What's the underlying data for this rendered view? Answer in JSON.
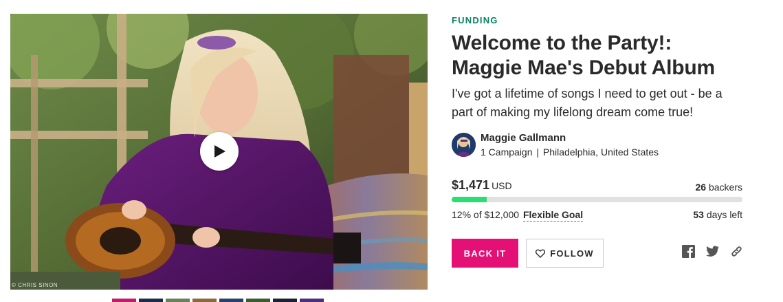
{
  "media": {
    "photo_credit": "© CHRIS SINON",
    "play_icon": "play-icon",
    "thumbnails": [
      {
        "color": "#c21b6d"
      },
      {
        "color": "#1e2a48"
      },
      {
        "color": "#6b7f5a"
      },
      {
        "color": "#8a6a3c"
      },
      {
        "color": "#2a3f6b"
      },
      {
        "color": "#3e5a2e"
      },
      {
        "color": "#1a2230"
      },
      {
        "color": "#4a2f7a"
      }
    ]
  },
  "campaign": {
    "category": "FUNDING",
    "title": "Welcome to the Party!: Maggie Mae's Debut Album",
    "tagline": "I've got a lifetime of songs I need to get out - be a part of making my lifelong dream come true!"
  },
  "owner": {
    "name": "Maggie Gallmann",
    "campaigns": "1 Campaign",
    "separator": "|",
    "location": "Philadelphia, United States"
  },
  "funding": {
    "amount": "$1,471",
    "currency": "USD",
    "backers_count": "26",
    "backers_label": "backers",
    "percent_funded": 0.12,
    "goal_text": "12% of $12,000",
    "goal_type": "Flexible Goal",
    "days_count": "53",
    "days_label": "days left"
  },
  "actions": {
    "back_label": "BACK IT",
    "follow_label": "FOLLOW",
    "follow_icon": "heart-icon"
  },
  "share": {
    "icons": [
      "facebook-icon",
      "twitter-icon",
      "link-icon"
    ]
  },
  "colors": {
    "category": "#088366",
    "back_button": "#e51075",
    "progress_fill": "#2bde73",
    "progress_track": "#e1e1e1"
  }
}
